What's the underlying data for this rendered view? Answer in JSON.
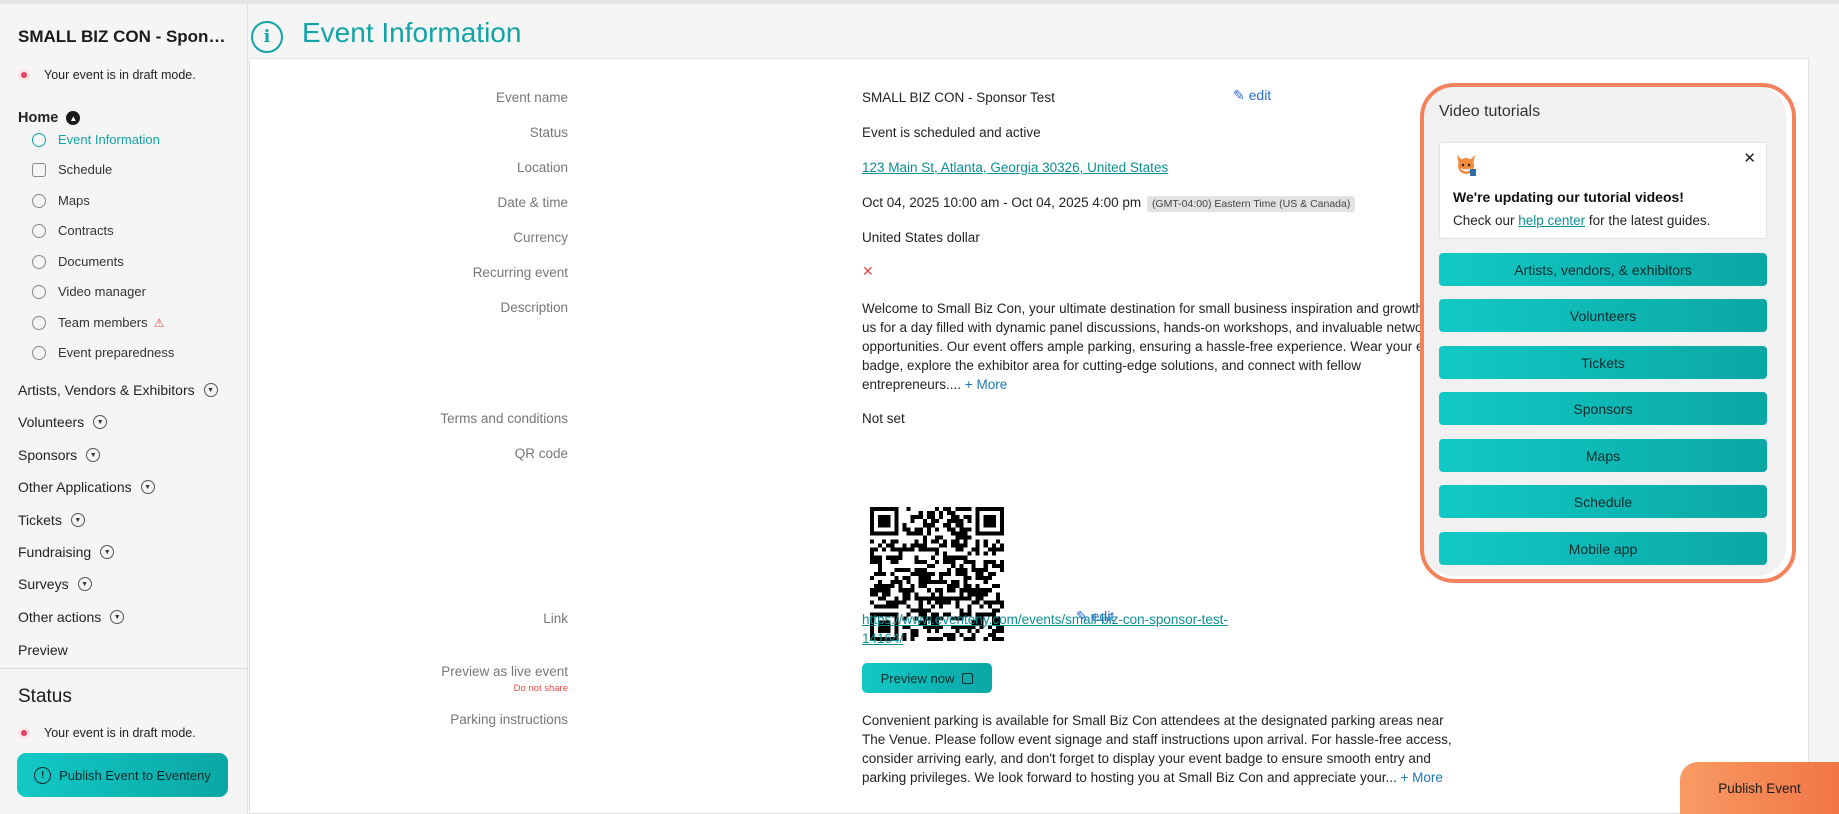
{
  "sidebar": {
    "event_title": "SMALL BIZ CON - Sponsor Test",
    "draft_text": "Your event is in draft mode.",
    "home_label": "Home",
    "home_items": [
      {
        "label": "Event Information"
      },
      {
        "label": "Schedule"
      },
      {
        "label": "Maps"
      },
      {
        "label": "Contracts"
      },
      {
        "label": "Documents"
      },
      {
        "label": "Video manager"
      },
      {
        "label": "Team members"
      },
      {
        "label": "Event preparedness"
      }
    ],
    "sections": [
      {
        "label": "Artists, Vendors & Exhibitors"
      },
      {
        "label": "Volunteers"
      },
      {
        "label": "Sponsors"
      },
      {
        "label": "Other Applications"
      },
      {
        "label": "Tickets"
      },
      {
        "label": "Fundraising"
      },
      {
        "label": "Surveys"
      },
      {
        "label": "Other actions"
      },
      {
        "label": "Preview"
      }
    ],
    "status_title": "Status",
    "status_draft_text": "Your event is in draft mode.",
    "publish_label": "Publish Event to Eventeny"
  },
  "header": {
    "title": "Event Information"
  },
  "event": {
    "name_label": "Event name",
    "name": "SMALL BIZ CON - Sponsor Test",
    "edit_label": "edit",
    "status_label": "Status",
    "status": "Event is scheduled and active",
    "location_label": "Location",
    "location": "123 Main St, Atlanta, Georgia 30326, United States",
    "datetime_label": "Date & time",
    "datetime": "Oct 04, 2025 10:00 am - Oct 04, 2025 4:00 pm",
    "timezone": "(GMT-04:00) Eastern Time (US & Canada)",
    "currency_label": "Currency",
    "currency": "United States dollar",
    "recurring_label": "Recurring event",
    "recurring_value": "✕",
    "description_label": "Description",
    "description": "Welcome to Small Biz Con, your ultimate destination for small business inspiration and growth! Join us for a day filled with dynamic panel discussions, hands-on workshops, and invaluable networking opportunities. Our event offers ample parking, ensuring a hassle-free experience. Wear your event badge, explore the exhibitor area for cutting-edge solutions, and connect with fellow entrepreneurs....",
    "more_label": "+ More",
    "terms_label": "Terms and conditions",
    "terms": "Not set",
    "qr_label": "QR code",
    "link_label": "Link",
    "link_line1": "https://www.eventeny.com/events/small-biz-con-sponsor-test-",
    "link_line2": "14164/",
    "link_edit_label": "edit",
    "preview_label": "Preview as live event",
    "do_not_share": "Do not share",
    "preview_button": "Preview now",
    "parking_label": "Parking instructions",
    "parking": "Convenient parking is available for Small Biz Con attendees at the designated parking areas near The Venue. Please follow event signage and staff instructions upon arrival. For hassle-free access, consider arriving early, and don't forget to display your event badge to ensure smooth entry and parking privileges. We look forward to hosting you at Small Biz Con and appreciate your...",
    "parking_more_label": "+ More"
  },
  "tutorials": {
    "title": "Video tutorials",
    "notice_heading": "We're updating our tutorial videos!",
    "notice_prefix": "Check our ",
    "notice_link": "help center",
    "notice_suffix": " for the latest guides.",
    "close_icon": "✕",
    "buttons": [
      {
        "label": "Artists, vendors, & exhibitors"
      },
      {
        "label": "Volunteers"
      },
      {
        "label": "Tickets"
      },
      {
        "label": "Sponsors"
      },
      {
        "label": "Maps"
      },
      {
        "label": "Schedule"
      },
      {
        "label": "Mobile app"
      }
    ]
  },
  "footer": {
    "publish_event": "Publish Event"
  },
  "colors": {
    "accent": "#12a3a6",
    "button_teal": "#12c9c6",
    "highlight_orange": "#f4835d",
    "draft_red": "#e8405a"
  }
}
